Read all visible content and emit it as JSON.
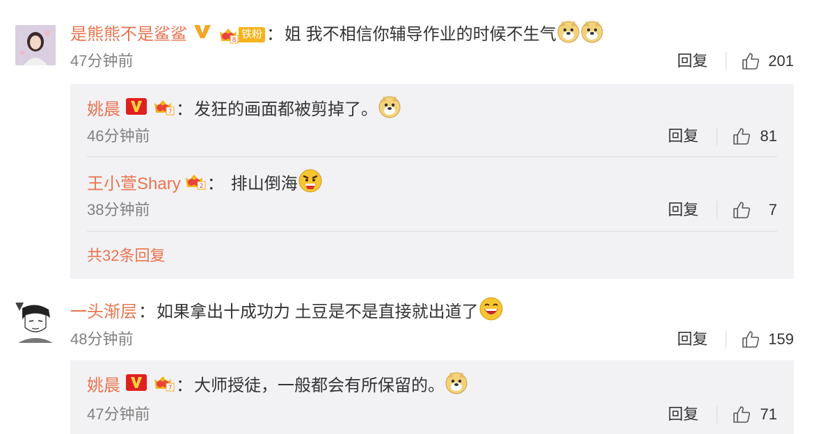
{
  "comments": [
    {
      "user": "是熊熊不是鲨鲨",
      "fan_badge": "铁粉",
      "text": "姐 我不相信你辅导作业的时候不生气",
      "time": "47分钟前",
      "reply_label": "回复",
      "likes": "201",
      "replies": [
        {
          "user": "姚晨",
          "text": "发狂的画面都被剪掉了。",
          "time": "46分钟前",
          "reply_label": "回复",
          "likes": "81"
        },
        {
          "user": "王小萱Shary",
          "text": "排山倒海",
          "time": "38分钟前",
          "reply_label": "回复",
          "likes": "7"
        }
      ],
      "more_replies": "共32条回复"
    },
    {
      "user": "一头渐层",
      "text": "如果拿出十成功力 土豆是不是直接就出道了",
      "time": "48分钟前",
      "reply_label": "回复",
      "likes": "159",
      "replies": [
        {
          "user": "姚晨",
          "text": "大师授徒，一般都会有所保留的。",
          "time": "47分钟前",
          "reply_label": "回复",
          "likes": "71"
        }
      ]
    }
  ],
  "colors": {
    "username": "#eb7350",
    "reply_bg": "#f2f2f5",
    "vip_v": "#f5a623",
    "verified_red": "#e02020"
  },
  "icons": [
    "avatar-girl",
    "avatar-manga",
    "verified-v-icon",
    "vip-crown-icon",
    "doge-emoji-icon",
    "angry-emoji-icon",
    "laugh-emoji-icon",
    "thumbs-up-icon"
  ]
}
